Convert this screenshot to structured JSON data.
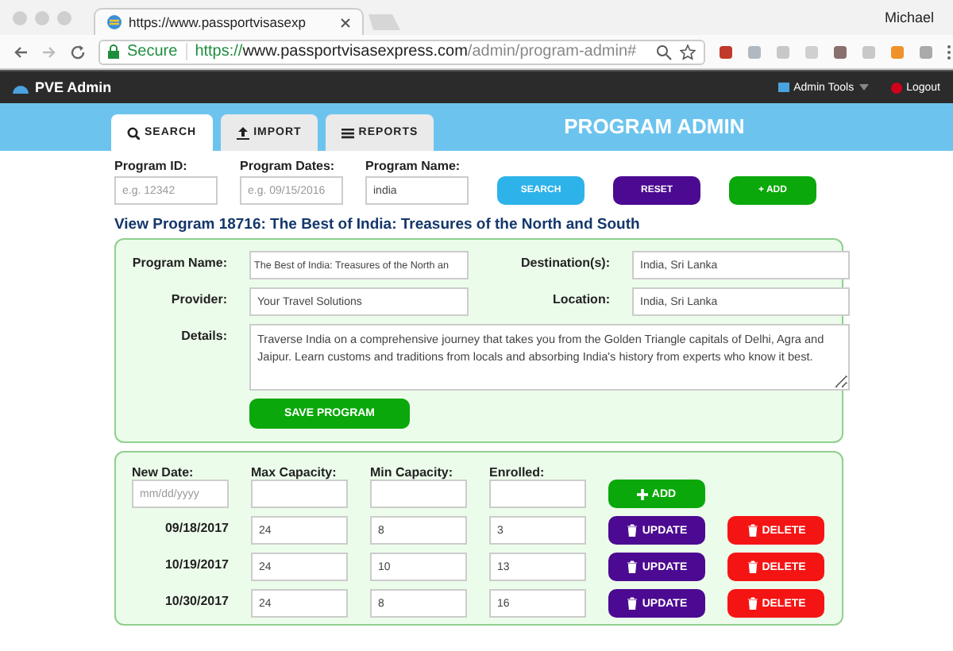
{
  "browser": {
    "tab_title": "https://www.passportvisasexp",
    "profile": "Michael",
    "secure_label": "Secure",
    "url_scheme": "https://",
    "url_host": "www.passportvisasexpress.com",
    "url_path": "/admin/program-admin#"
  },
  "navbar": {
    "brand": "PVE Admin",
    "admin_tools": "Admin Tools",
    "logout": "Logout"
  },
  "tabs": [
    {
      "label": "SEARCH",
      "selected": true
    },
    {
      "label": "IMPORT",
      "selected": false
    },
    {
      "label": "REPORTS",
      "selected": false
    }
  ],
  "banner_title": "PROGRAM ADMIN",
  "search": {
    "fields": [
      {
        "label": "Program ID:",
        "placeholder": "e.g. 12342"
      },
      {
        "label": "Program Dates:",
        "placeholder": "e.g. 09/15/2016"
      },
      {
        "label": "Program Name:",
        "value": "india"
      }
    ],
    "buttons": [
      {
        "label": "SEARCH",
        "kind": "search"
      },
      {
        "label": "RESET",
        "kind": "reset"
      },
      {
        "label": "+ ADD",
        "kind": "add"
      }
    ]
  },
  "view_title": "View Program 18716: The Best of India: Treasures of the North and South",
  "program": {
    "fields": [
      {
        "label": "Program Name:",
        "value": "The Best of India: Treasures of the North an"
      },
      {
        "label": "Destination(s):",
        "value": "India, Sri Lanka"
      },
      {
        "label": "Provider:",
        "value": "Your Travel Solutions"
      },
      {
        "label": "Location:",
        "value": "India, Sri Lanka"
      }
    ],
    "details_label": "Details:",
    "details": "Traverse India on a comprehensive journey that takes you from the Golden Triangle capitals of Delhi, Agra and Jaipur. Learn customs and traditions from locals and absorbing India's history from experts who know it best.",
    "save_button": "SAVE PROGRAM"
  },
  "dates": {
    "columns": [
      "New Date:",
      "Max Capacity:",
      "Min Capacity:",
      "Enrolled:"
    ],
    "new_date_placeholder": "mm/dd/yyyy",
    "add_button": "ADD",
    "rows": [
      {
        "date": "09/18/2017",
        "max": "24",
        "min": "8",
        "enrolled": "3",
        "update": "UPDATE",
        "delete": "DELETE"
      },
      {
        "date": "10/19/2017",
        "max": "24",
        "min": "10",
        "enrolled": "13",
        "update": "UPDATE",
        "delete": "DELETE"
      },
      {
        "date": "10/30/2017",
        "max": "24",
        "min": "8",
        "enrolled": "16",
        "update": "UPDATE",
        "delete": "DELETE"
      }
    ]
  }
}
